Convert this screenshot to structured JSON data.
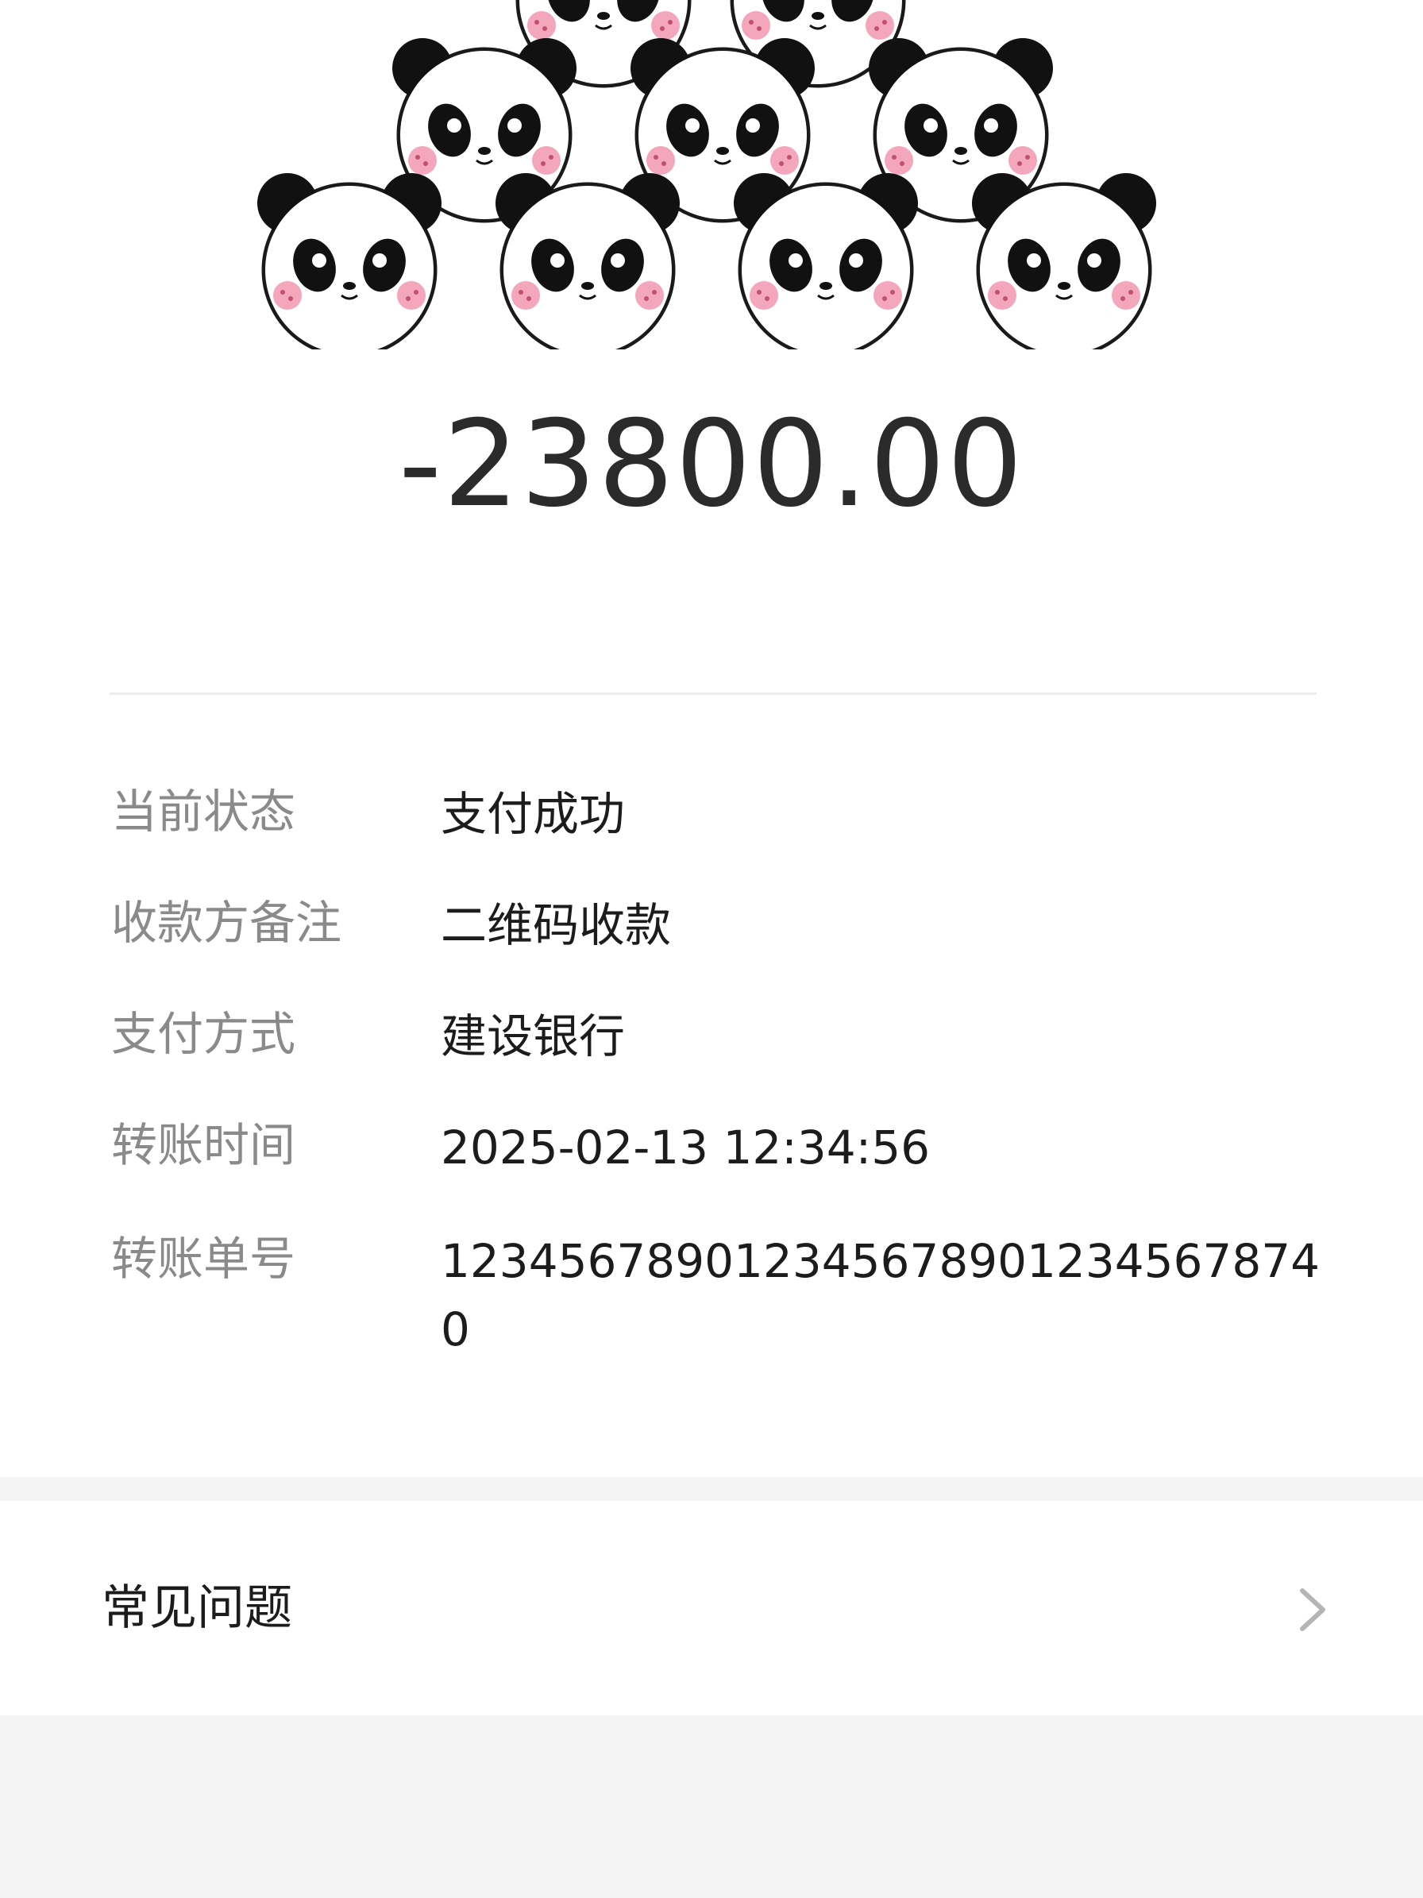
{
  "amount": "-23800.00",
  "details": [
    {
      "label": "当前状态",
      "value": "支付成功"
    },
    {
      "label": "收款方备注",
      "value": "二维码收款"
    },
    {
      "label": "支付方式",
      "value": "建设银行"
    },
    {
      "label": "转账时间",
      "value": "2025-02-13 12:34:56"
    },
    {
      "label": "转账单号",
      "value": "1234567890123456789012345678740"
    }
  ],
  "faq": {
    "label": "常见问题",
    "icon": "chevron-right-icon"
  },
  "banner": {
    "icon": "panda-pattern-image"
  },
  "colors": {
    "amount": "#2b2b2b",
    "label": "#8a8a8a",
    "value": "#1c1c1c",
    "band": "#f4f4f4",
    "blush": "#f4a6bd"
  }
}
